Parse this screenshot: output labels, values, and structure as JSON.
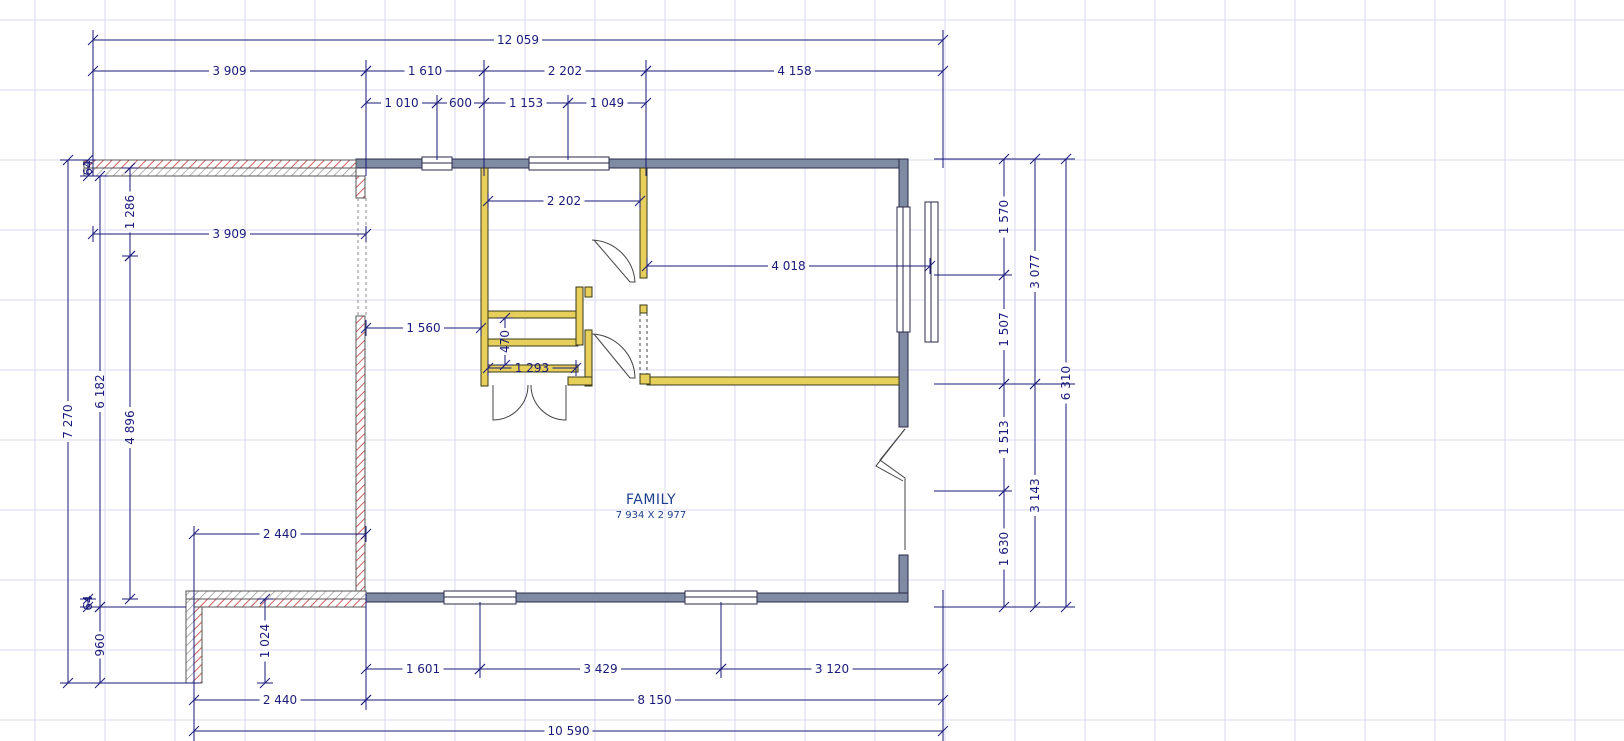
{
  "room": {
    "name": "FAMILY",
    "size": "7 934 X 2 977"
  },
  "colors": {
    "grid": "#d8d8f0",
    "dimension": "#1a1a7a",
    "exterior_wall": "#7f8aa3",
    "interior_wall": "#e7cf5c",
    "hatched_wall": "#d06060",
    "room_label": "#1c3f8c"
  },
  "dimensions": {
    "overall_top": "12 059",
    "top_segment_1": "3 909",
    "top_segment_2": "1 610",
    "top_segment_3": "2 202",
    "top_segment_4": "4 158",
    "window_top_1": "1 010",
    "window_top_2": "600",
    "window_top_3": "1 153",
    "window_top_4": "1 049",
    "closet_width": "2 202",
    "bedroom_width": "4 018",
    "porch_width": "3 909",
    "porch_depth": "1 286",
    "wall_offset": "1 560",
    "closet_small": "470",
    "closet_depth": "1 293",
    "left_seg_small": "64",
    "left_total": "7 270",
    "left_mid": "6 182",
    "left_inner": "4 896",
    "bottom_left_width": "2 440",
    "bottom_left_small_a": "64",
    "bottom_left_small_b": "960",
    "bottom_left_depth": "1 024",
    "bottom_seg_1": "1 601",
    "bottom_seg_2": "3 429",
    "bottom_seg_3": "3 120",
    "bottom_row2_a": "2 440",
    "bottom_row2_b": "8 150",
    "overall_bottom": "10 590",
    "right_1": "1 570",
    "right_2": "1 507",
    "right_3": "1 513",
    "right_4": "1 630",
    "right_mid_1": "3 077",
    "right_mid_2": "3 143",
    "right_total": "6 310"
  }
}
